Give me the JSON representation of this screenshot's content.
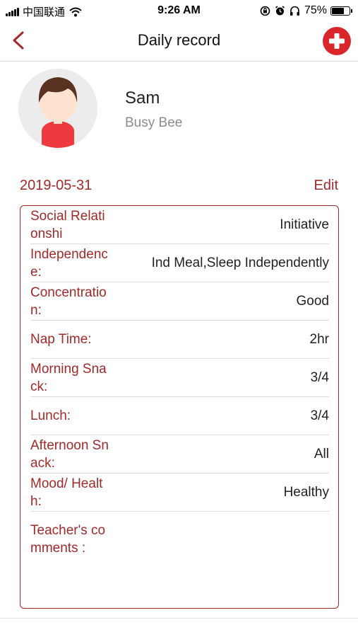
{
  "status_bar": {
    "carrier": "中国联通",
    "time": "9:26 AM",
    "battery_percent": "75%",
    "battery_level": 0.75,
    "icons": [
      "signal-icon",
      "wifi-icon",
      "screen-lock-icon",
      "alarm-icon",
      "headphones-icon",
      "battery-icon"
    ]
  },
  "nav": {
    "title": "Daily record",
    "back_icon": "chevron-left-icon",
    "add_icon": "plus-circle-icon"
  },
  "profile": {
    "name": "Sam",
    "class_name": "Busy Bee"
  },
  "record": {
    "date": "2019-05-31",
    "edit_label": "Edit",
    "rows": [
      {
        "label": "Social Relationshi",
        "value": "Initiative"
      },
      {
        "label": "Independence:",
        "value": "Ind Meal,Sleep Independently"
      },
      {
        "label": "Concentration:",
        "value": "Good"
      },
      {
        "label": "Nap Time:",
        "value": "2hr"
      },
      {
        "label": "Morning Snack:",
        "value": "3/4"
      },
      {
        "label": "Lunch:",
        "value": "3/4"
      },
      {
        "label": "Afternoon Snack:",
        "value": "All"
      },
      {
        "label": "Mood/ Health:",
        "value": "Healthy"
      }
    ],
    "comments_label": "Teacher's comments :",
    "comments_value": ""
  },
  "colors": {
    "accent": "#a02a2a",
    "add_button": "#d8262b",
    "avatar_bg": "#ececec",
    "avatar_hair": "#5a3222",
    "avatar_skin": "#fde3cf",
    "avatar_shirt": "#ee3a3e"
  }
}
